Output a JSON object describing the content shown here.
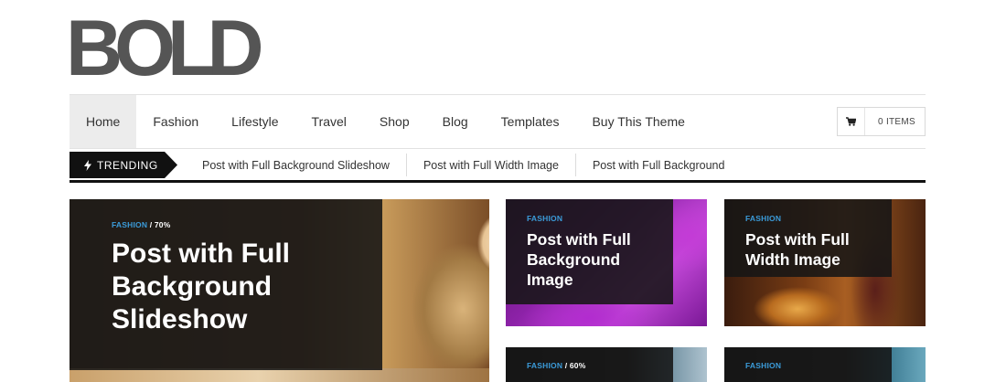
{
  "brand": {
    "logo_text": "BOLD",
    "logo_color": "#555555"
  },
  "nav": {
    "items": [
      {
        "label": "Home",
        "active": true
      },
      {
        "label": "Fashion"
      },
      {
        "label": "Lifestyle"
      },
      {
        "label": "Travel"
      },
      {
        "label": "Shop"
      },
      {
        "label": "Blog"
      },
      {
        "label": "Templates"
      },
      {
        "label": "Buy This Theme"
      }
    ],
    "cart": {
      "icon": "cart-icon",
      "label": "0 ITEMS"
    }
  },
  "trending": {
    "label": "TRENDING",
    "icon": "lightning-icon",
    "links": [
      "Post with Full Background Slideshow",
      "Post with Full Width Image",
      "Post with Full Background"
    ]
  },
  "posts": {
    "featured": {
      "category": "FASHION",
      "score": "/ 70%",
      "title_lines": [
        "Post with Full",
        "Background",
        "Slideshow"
      ]
    },
    "card1": {
      "category": "FASHION",
      "title_lines": [
        "Post with Full",
        "Background",
        "Image"
      ]
    },
    "card2": {
      "category": "FASHION",
      "title_lines": [
        "Post with Full",
        "Width Image"
      ]
    },
    "card3": {
      "category": "FASHION",
      "score": "/ 60%"
    },
    "card4": {
      "category": "FASHION"
    }
  },
  "colors": {
    "accent_blue": "#3b9bd9",
    "overlay": "#161616",
    "trend_bg": "#111111"
  }
}
